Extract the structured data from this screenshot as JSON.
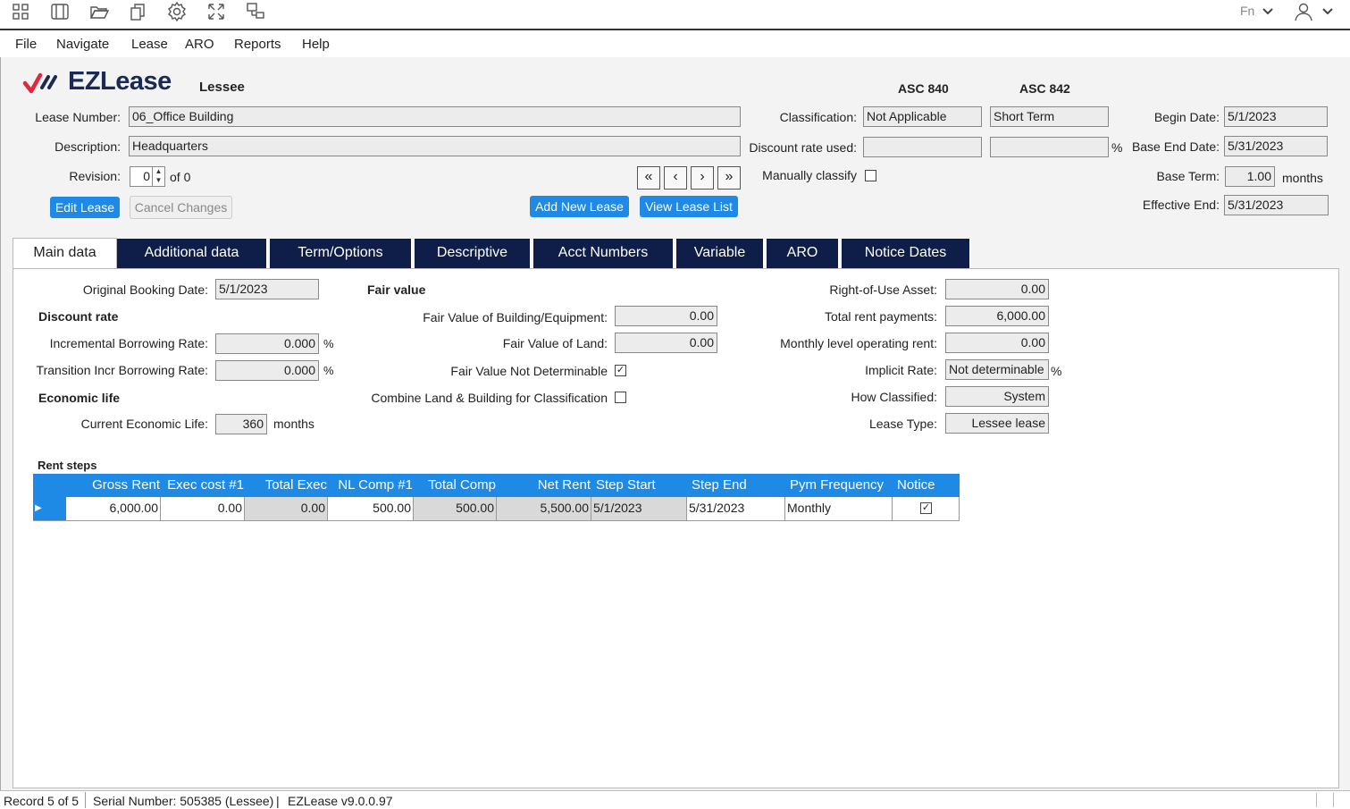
{
  "toolbar": {
    "icons": [
      "grid-icon",
      "panels-icon",
      "folder-open-icon",
      "copy-icon",
      "gear-icon",
      "expand-icon",
      "network-icon"
    ],
    "fn_label": "Fn"
  },
  "menu": [
    "File",
    "Navigate",
    "Lease",
    "ARO",
    "Reports",
    "Help"
  ],
  "brand": {
    "logo_text": "EZLease",
    "mode": "Lessee",
    "accent": "#e2263b",
    "navy": "#1a2a55"
  },
  "header": {
    "lease_number_label": "Lease Number:",
    "lease_number": "06_Office Building",
    "description_label": "Description:",
    "description": "Headquarters",
    "revision_label": "Revision:",
    "revision": "0",
    "revision_of": "of 0",
    "asc840": "ASC 840",
    "asc842": "ASC 842",
    "classification_label": "Classification:",
    "class_840": "Not Applicable",
    "class_842": "Short Term",
    "discount_rate_label": "Discount rate used:",
    "disc_840": "",
    "disc_842": "",
    "pct": "%",
    "manually_label": "Manually classify",
    "begin_date_label": "Begin Date:",
    "begin_date": "5/1/2023",
    "base_end_label": "Base End Date:",
    "base_end": "5/31/2023",
    "base_term_label": "Base Term:",
    "base_term": "1.00",
    "months": "months",
    "effective_end_label": "Effective End:",
    "effective_end": "5/31/2023"
  },
  "buttons": {
    "edit": "Edit Lease",
    "cancel": "Cancel Changes",
    "add_new": "Add New Lease",
    "view_list": "View Lease List",
    "nav": [
      "«",
      "‹",
      "›",
      "»"
    ]
  },
  "tabs": [
    "Main data",
    "Additional data",
    "Term/Options",
    "Descriptive",
    "Acct Numbers",
    "Variable",
    "ARO",
    "Notice Dates"
  ],
  "main": {
    "orig_booking_label": "Original Booking Date:",
    "orig_booking": "5/1/2023",
    "discount_rate_head": "Discount rate",
    "ibr_label": "Incremental Borrowing Rate:",
    "ibr": "0.000",
    "tibr_label": "Transition Incr Borrowing Rate:",
    "tibr": "0.000",
    "pct": "%",
    "econ_head": "Economic life",
    "cel_label": "Current Economic Life:",
    "cel": "360",
    "months": "months",
    "fair_value_head": "Fair value",
    "fvbe_label": "Fair Value of Building/Equipment:",
    "fvbe": "0.00",
    "fvl_label": "Fair Value of Land:",
    "fvl": "0.00",
    "fvnd_label": "Fair Value Not Determinable",
    "fvnd_checked": true,
    "combine_label": "Combine Land & Building for Classification",
    "combine_checked": false,
    "rou_label": "Right-of-Use Asset:",
    "rou": "0.00",
    "trp_label": "Total rent payments:",
    "trp": "6,000.00",
    "mlor_label": "Monthly level operating rent:",
    "mlor": "0.00",
    "implicit_label": "Implicit Rate:",
    "implicit": "Not determinable",
    "how_label": "How Classified:",
    "how": "System",
    "lease_type_label": "Lease Type:",
    "lease_type": "Lessee lease"
  },
  "rent_steps": {
    "title": "Rent steps",
    "headers": [
      "Gross Rent",
      "Exec cost #1",
      "Total Exec",
      "NL Comp #1",
      "Total Comp",
      "Net Rent",
      "Step Start",
      "Step End",
      "Pym Frequency",
      "Notice"
    ],
    "row": [
      "6,000.00",
      "0.00",
      "0.00",
      "500.00",
      "500.00",
      "5,500.00",
      "5/1/2023",
      "5/31/2023",
      "Monthly"
    ],
    "notice_checked": true
  },
  "status": {
    "record": "Record 5 of 5",
    "serial": "Serial Number: 505385 (Lessee)",
    "version": "EZLease v9.0.0.97"
  }
}
